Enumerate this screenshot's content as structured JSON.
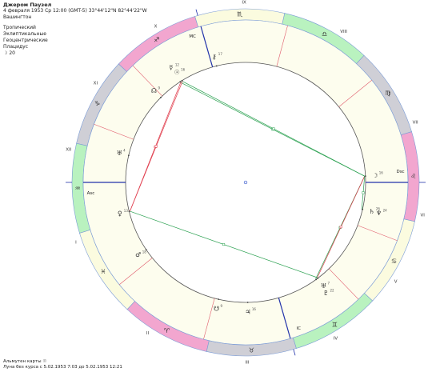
{
  "header": {
    "name": "Джером Паузел",
    "date_line": "4 февраля 1953  Ср  12:00 (GMT-5) 33°44'12\"N  82°44'22\"W",
    "place": "Вашингтон",
    "zodiac": "Тропический",
    "coords": "Эклиптикальные",
    "center": "Геоцентрические",
    "houses": "Плацидус",
    "moon_label": "☽",
    "moon_value": "20"
  },
  "footer": {
    "line1": "Альмутен карты",
    "line1_symbol": "☉",
    "line2": "Луна без курса с 5.02.1953  7:03 до 5.02.1953 12:21"
  },
  "colors": {
    "fire": "#f2a6cf",
    "earth": "#cfcfd6",
    "air": "#b9f2bf",
    "water": "#fbfbdf",
    "ring_stroke": "#7a9bd6",
    "house_line": "#e05a6a",
    "axis": "#2233aa",
    "aspect_red": "#e03a4a",
    "aspect_green": "#2aa050"
  },
  "zodiac_signs": [
    {
      "glyph": "♈",
      "element": "fire"
    },
    {
      "glyph": "♉",
      "element": "earth"
    },
    {
      "glyph": "♊",
      "element": "air"
    },
    {
      "glyph": "♋",
      "element": "water"
    },
    {
      "glyph": "♌",
      "element": "fire"
    },
    {
      "glyph": "♍",
      "element": "earth"
    },
    {
      "glyph": "♎",
      "element": "air"
    },
    {
      "glyph": "♏",
      "element": "water"
    },
    {
      "glyph": "♐",
      "element": "fire"
    },
    {
      "glyph": "♑",
      "element": "earth"
    },
    {
      "glyph": "♒",
      "element": "air"
    },
    {
      "glyph": "♓",
      "element": "water"
    }
  ],
  "asc_longitude": 313,
  "house_cusps": [
    {
      "label": "I",
      "lon": 313
    },
    {
      "label": "II",
      "lon": 352
    },
    {
      "label": "III",
      "lon": 28
    },
    {
      "label": "IV",
      "lon": 59
    },
    {
      "label": "V",
      "lon": 87
    },
    {
      "label": "VI",
      "lon": 112
    },
    {
      "label": "VII",
      "lon": 133
    },
    {
      "label": "VIII",
      "lon": 172
    },
    {
      "label": "IX",
      "lon": 208
    },
    {
      "label": "X",
      "lon": 239
    },
    {
      "label": "XI",
      "lon": 267
    },
    {
      "label": "XII",
      "lon": 292
    }
  ],
  "axes": [
    {
      "label": "Asc",
      "lon": 313
    },
    {
      "label": "IC",
      "lon": 59
    },
    {
      "label": "Dsc",
      "lon": 133
    },
    {
      "label": "MC",
      "lon": 239
    }
  ],
  "planets": [
    {
      "glyph": "☉",
      "deg": "16",
      "lon": 255
    },
    {
      "glyph": "☽",
      "deg": "16",
      "lon": 136
    },
    {
      "glyph": "☿",
      "deg": "12",
      "lon": 256
    },
    {
      "glyph": "♀",
      "deg": "13",
      "lon": 327
    },
    {
      "glyph": "♂",
      "deg": "18",
      "lon": 347
    },
    {
      "glyph": "♃",
      "deg": "16",
      "lon": 44
    },
    {
      "glyph": "♄",
      "deg": "26",
      "lon": 120
    },
    {
      "glyph": "♅",
      "deg": "7",
      "lon": 80
    },
    {
      "glyph": "♆",
      "deg": "24",
      "lon": 120
    },
    {
      "glyph": "♇",
      "deg": "22",
      "lon": 79
    },
    {
      "glyph": "☊",
      "deg": "9",
      "lon": 268
    },
    {
      "glyph": "⚷",
      "deg": "17",
      "lon": 237
    },
    {
      "glyph": "☋",
      "deg": "9",
      "lon": 30
    },
    {
      "glyph": "♅",
      "deg": "4",
      "lon": 300
    }
  ],
  "aspects": [
    {
      "from": 1,
      "to": 2,
      "color": "green"
    },
    {
      "from": 1,
      "to": 0,
      "color": "green"
    },
    {
      "from": 1,
      "to": 9,
      "color": "green"
    },
    {
      "from": 1,
      "to": 7,
      "color": "red"
    },
    {
      "from": 2,
      "to": 3,
      "color": "red"
    },
    {
      "from": 0,
      "to": 3,
      "color": "red"
    },
    {
      "from": 3,
      "to": 7,
      "color": "green"
    },
    {
      "from": 1,
      "to": 6,
      "color": "green"
    }
  ]
}
